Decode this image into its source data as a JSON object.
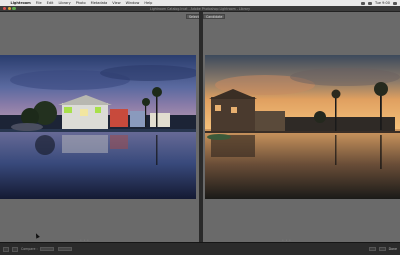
{
  "menubar": {
    "app_name": "Lightroom",
    "items": [
      "File",
      "Edit",
      "Library",
      "Photo",
      "Metadata",
      "View",
      "Window",
      "Help"
    ],
    "right_text": "Tue 9:00"
  },
  "window": {
    "title": "Lightroom Catalog.lrcat - Adobe Photoshop Lightroom - Library"
  },
  "compare": {
    "left_label": "Select",
    "right_label": "Candidate"
  },
  "toolbar": {
    "compare_label": "Compare :",
    "right_button_label": "Done"
  },
  "colors": {
    "panel_bg": "#6a6a6a",
    "chrome_dark": "#2b2b2b",
    "menubar": "#e9e9e9"
  }
}
